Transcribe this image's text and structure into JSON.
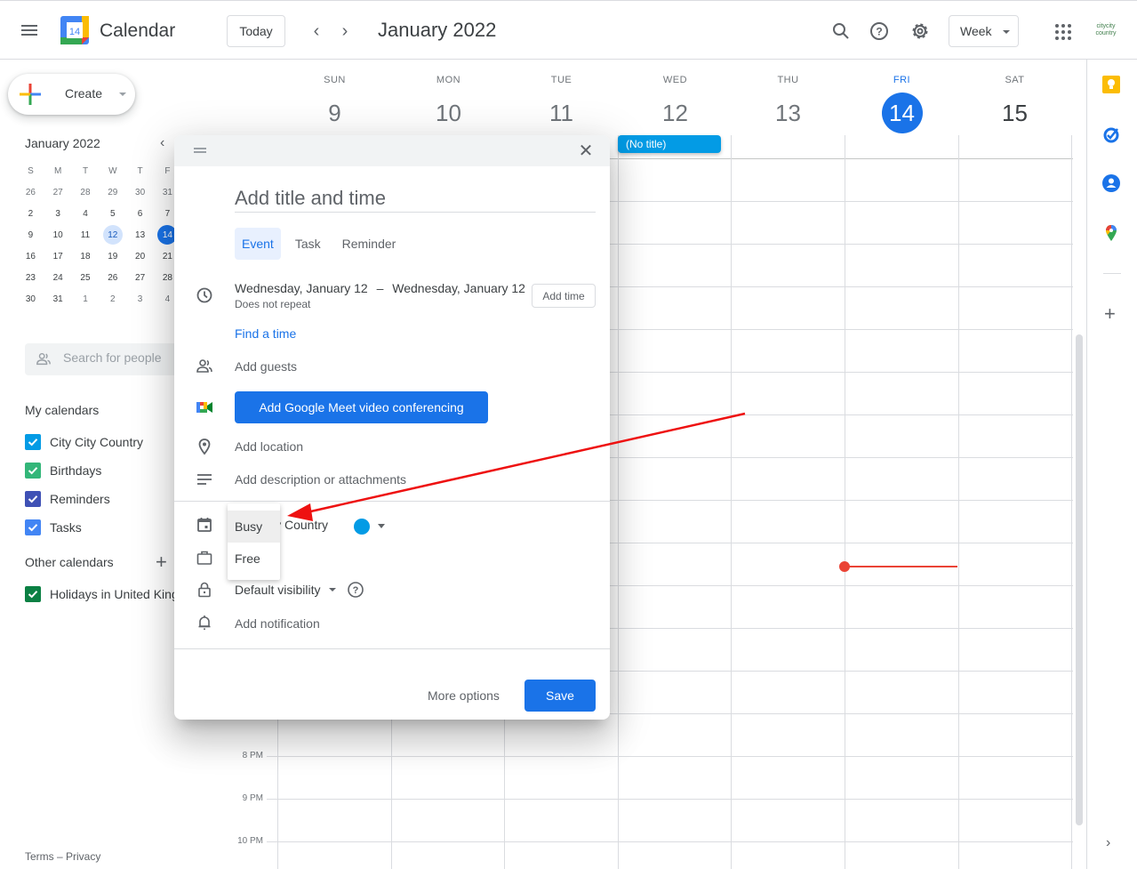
{
  "header": {
    "app_title": "Calendar",
    "logo_day": "14",
    "today_label": "Today",
    "prev_label": "‹",
    "next_label": "›",
    "month_title": "January 2022",
    "view_selector": "Week",
    "org_logo_line1": "citycity",
    "org_logo_line2": "country",
    "icons": [
      "menu-icon",
      "search-icon",
      "help-icon",
      "gear-icon",
      "apps-icon"
    ]
  },
  "sidebar": {
    "create_label": "Create",
    "mini_calendar": {
      "title": "January 2022",
      "weekday_headers": [
        "S",
        "M",
        "T",
        "W",
        "T",
        "F"
      ],
      "weeks": [
        [
          "26",
          "27",
          "28",
          "29",
          "30",
          "31"
        ],
        [
          "2",
          "3",
          "4",
          "5",
          "6",
          "7"
        ],
        [
          "9",
          "10",
          "11",
          "12",
          "13",
          "14"
        ],
        [
          "16",
          "17",
          "18",
          "19",
          "20",
          "21"
        ],
        [
          "23",
          "24",
          "25",
          "26",
          "27",
          "28"
        ],
        [
          "30",
          "31",
          "1",
          "2",
          "3",
          "4"
        ]
      ],
      "selected_day": "12",
      "today": "14"
    },
    "people_search_placeholder": "Search for people",
    "my_calendars_title": "My calendars",
    "my_calendars": [
      {
        "name": "City City Country",
        "color": "#039be5",
        "checked": true
      },
      {
        "name": "Birthdays",
        "color": "#33b679",
        "checked": true
      },
      {
        "name": "Reminders",
        "color": "#3f51b5",
        "checked": true
      },
      {
        "name": "Tasks",
        "color": "#4285f4",
        "checked": true
      }
    ],
    "other_calendars_title": "Other calendars",
    "other_calendars": [
      {
        "name": "Holidays in United Kingdom",
        "color": "#0b8043",
        "checked": true
      }
    ],
    "footer_links": "Terms – Privacy"
  },
  "week": {
    "days": [
      {
        "dow": "SUN",
        "num": "9",
        "state": "past"
      },
      {
        "dow": "MON",
        "num": "10",
        "state": "past"
      },
      {
        "dow": "TUE",
        "num": "11",
        "state": "past"
      },
      {
        "dow": "WED",
        "num": "12",
        "state": "past"
      },
      {
        "dow": "THU",
        "num": "13",
        "state": "past"
      },
      {
        "dow": "FRI",
        "num": "14",
        "state": "today"
      },
      {
        "dow": "SAT",
        "num": "15",
        "state": "future"
      }
    ],
    "time_labels": [
      "8 PM",
      "9 PM",
      "10 PM"
    ],
    "all_day_event": {
      "title": "(No title)",
      "day": "WED",
      "color": "#039be5"
    },
    "current_time_indicator": {
      "day": "FRI",
      "color": "#ea4335"
    }
  },
  "side_panel": {
    "icons": [
      "keep-icon",
      "tasks-icon",
      "contacts-icon",
      "maps-icon"
    ],
    "add_label": "+",
    "expand_label": "›"
  },
  "dialog": {
    "title_placeholder": "Add title and time",
    "tabs": [
      {
        "label": "Event",
        "active": true
      },
      {
        "label": "Task",
        "active": false
      },
      {
        "label": "Reminder",
        "active": false
      }
    ],
    "start_date": "Wednesday, January 12",
    "date_separator": "–",
    "end_date": "Wednesday, January 12",
    "recurrence": "Does not repeat",
    "add_time_label": "Add time",
    "find_time_label": "Find a time",
    "add_guests_label": "Add guests",
    "meet_button_label": "Add Google Meet video conferencing",
    "add_location_label": "Add location",
    "add_description_label": "Add description or attachments",
    "calendar_name": "City City Country",
    "calendar_color": "#039be5",
    "visibility_label": "Default visibility",
    "add_notification_label": "Add notification",
    "more_options_label": "More options",
    "save_label": "Save",
    "close_label": "✕"
  },
  "availability_menu": {
    "options": [
      "Busy",
      "Free"
    ],
    "highlighted": "Busy"
  },
  "annotation": {
    "type": "arrow",
    "color": "#ee1111",
    "points_to": "Busy"
  }
}
